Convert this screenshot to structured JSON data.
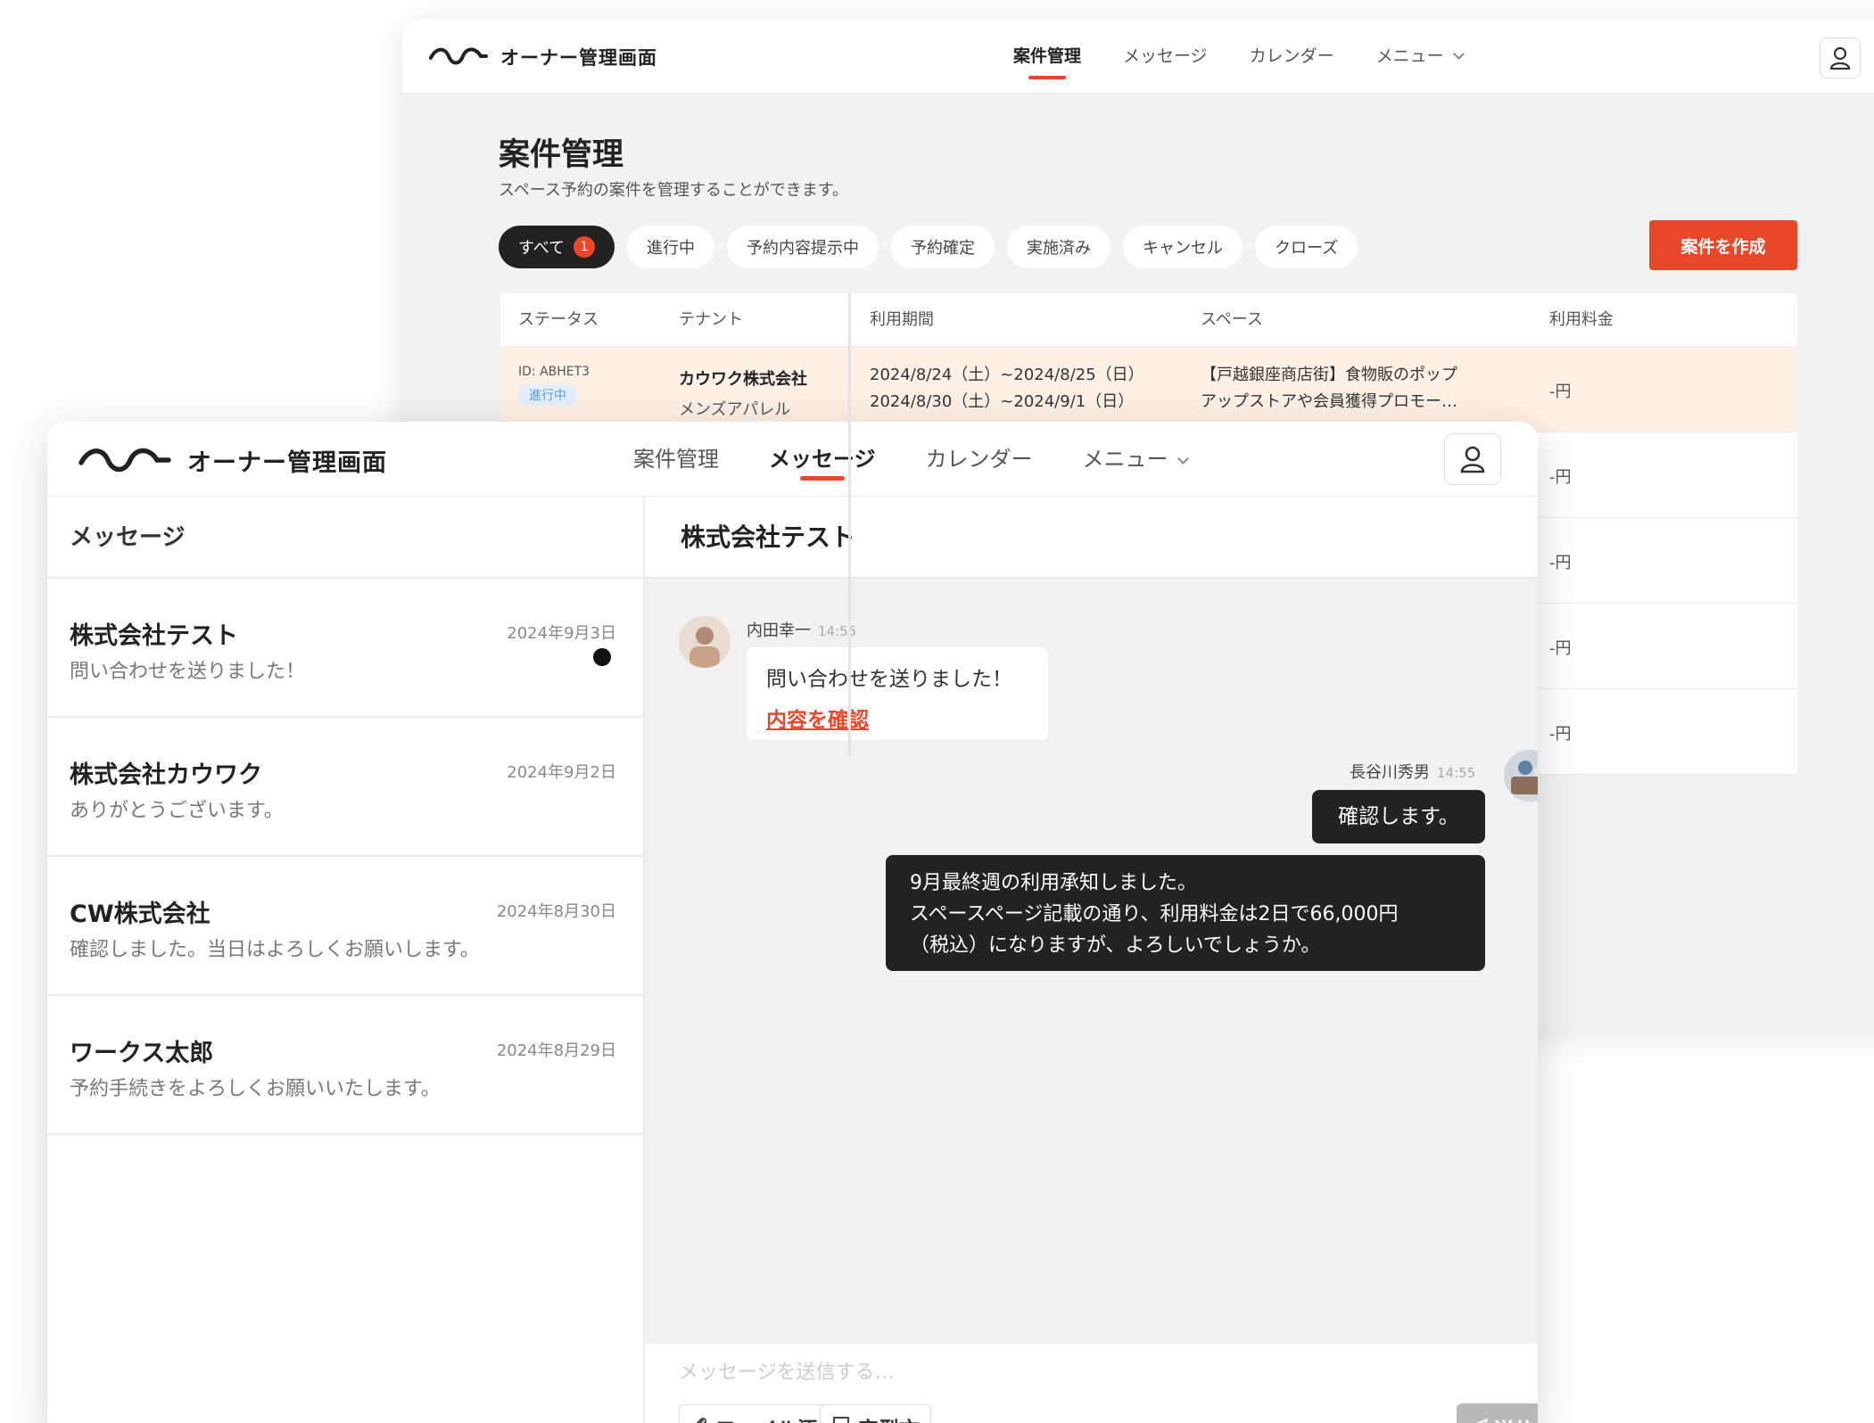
{
  "brand": {
    "logo_icon": "wave-logo-icon",
    "name": "オーナー管理画面",
    "accent_color": "#e8472a"
  },
  "back_window": {
    "nav": [
      "案件管理",
      "メッセージ",
      "カレンダー",
      "メニュー"
    ],
    "active_nav": "案件管理",
    "title": "案件管理",
    "subtitle": "スペース予約の案件を管理することができます。",
    "filters": [
      {
        "label": "すべて",
        "badge": "1"
      },
      {
        "label": "進行中"
      },
      {
        "label": "予約内容提示中"
      },
      {
        "label": "予約確定"
      },
      {
        "label": "実施済み"
      },
      {
        "label": "キャンセル"
      },
      {
        "label": "クローズ"
      }
    ],
    "create_button": "案件を作成",
    "table": {
      "columns": [
        "ステータス",
        "テナント",
        "利用期間",
        "スペース",
        "利用料金"
      ],
      "rows": [
        {
          "id": "ID: ABHET3",
          "status": "進行中",
          "tenant_line1": "カウワク株式会社",
          "tenant_line2": "メンズアパレル",
          "period_line1": "2024/8/24（土）~2024/8/25（日）",
          "period_line2": "2024/8/30（土）~2024/9/1（日）",
          "space_line1": "【戸越銀座商店街】食物販のポップ",
          "space_line2": "アップストアや会員獲得プロモー…",
          "fee": "-円"
        },
        {
          "fee": "-円"
        },
        {
          "fee": "-円"
        },
        {
          "fee": "-円"
        },
        {
          "fee": "-円"
        }
      ]
    }
  },
  "front_window": {
    "nav": [
      "案件管理",
      "メッセージ",
      "カレンダー",
      "メニュー"
    ],
    "active_nav": "メッセージ",
    "list_title": "メッセージ",
    "conversations": [
      {
        "name": "株式会社テスト",
        "date": "2024年9月3日",
        "preview": "問い合わせを送りました！",
        "unread": true
      },
      {
        "name": "株式会社カウワク",
        "date": "2024年9月2日",
        "preview": "ありがとうございます。",
        "unread": false
      },
      {
        "name": "CW株式会社",
        "date": "2024年8月30日",
        "preview": "確認しました。当日はよろしくお願いします。",
        "unread": false
      },
      {
        "name": "ワークス太郎",
        "date": "2024年8月29日",
        "preview": "予約手続きをよろしくお願いいたします。",
        "unread": false
      }
    ],
    "chat": {
      "title": "株式会社テスト",
      "messages": [
        {
          "sender": "内田幸一",
          "time": "14:55",
          "text": "問い合わせを送りました！",
          "link": "内容を確認",
          "direction": "in"
        },
        {
          "sender": "長谷川秀男",
          "time": "14:55",
          "text": "確認します。",
          "direction": "out"
        },
        {
          "direction": "out",
          "lines": [
            "9月最終週の利用承知しました。",
            "スペースページ記載の通り、利用料金は2日で66,000円",
            "（税込）になりますが、よろしいでしょうか。"
          ]
        }
      ],
      "composer": {
        "placeholder": "メッセージを送信する…",
        "attach_label": "ファイル添付",
        "attach_icon": "paperclip-icon",
        "template_label": "定型文",
        "template_icon": "speech-bubble-icon",
        "send_label": "送信",
        "send_icon": "paper-plane-icon"
      }
    }
  }
}
